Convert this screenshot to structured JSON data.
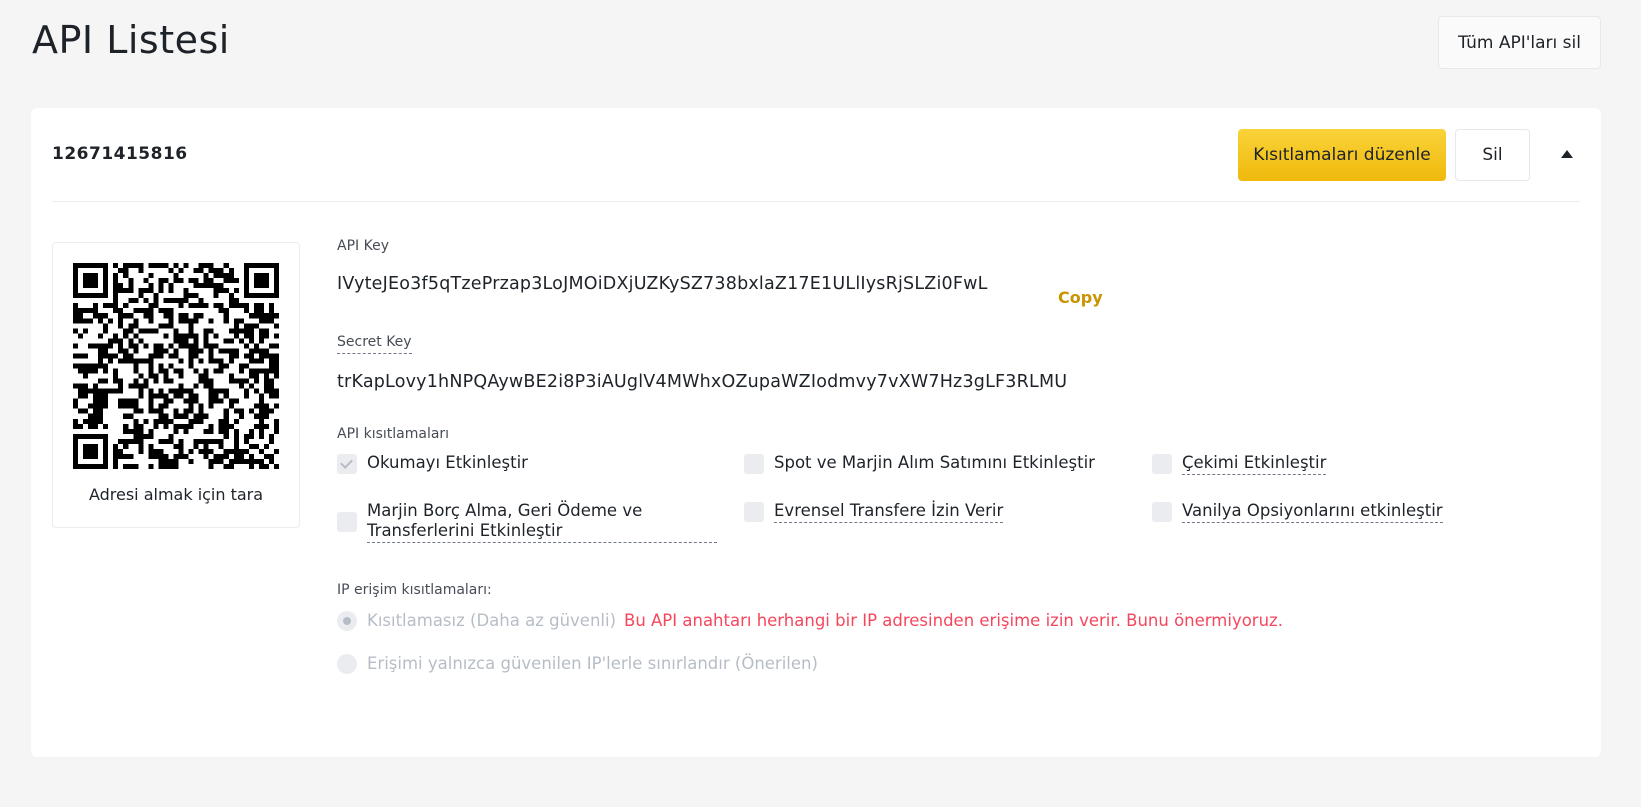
{
  "page": {
    "title": "API Listesi",
    "delete_all_label": "Tüm API'ları sil"
  },
  "api_card": {
    "id": "12671415816",
    "edit_label": "Kısıtlamaları düzenle",
    "delete_label": "Sil",
    "qr_caption": "Adresi almak için tara",
    "api_key_label": "API Key",
    "api_key_value": "IVyteJEo3f5qTzePrzap3LoJMOiDXjUZKySZ738bxlaZ17E1ULlIysRjSLZi0FwL",
    "copy_label": "Copy",
    "secret_key_label": "Secret Key",
    "secret_key_value": "trKapLovy1hNPQAywBE2i8P3iAUglV4MWhxOZupaWZIodmvy7vXW7Hz3gLF3RLMU",
    "restrictions_label": "API kısıtlamaları",
    "restrictions": {
      "read": "Okumayı Etkinleştir",
      "spot": "Spot ve Marjin Alım Satımını Etkinleştir",
      "withdraw": "Çekimi Etkinleştir",
      "margin_line1": "Marjin Borç Alma, Geri Ödeme ve",
      "margin_line2": "Transferlerini Etkinleştir",
      "universal": "Evrensel Transfere İzin Verir",
      "vanilla": "Vanilya Opsiyonlarını etkinleştir"
    },
    "ip_label": "IP erişim kısıtlamaları:",
    "ip_unrestricted": "Kısıtlamasız (Daha az güvenli)",
    "ip_warning": "Bu API anahtarı herhangi bir IP adresinden erişime izin verir. Bunu önermiyoruz.",
    "ip_trusted": "Erişimi yalnızca güvenilen IP'lerle sınırlandır (Önerilen)"
  },
  "colors": {
    "accent": "#f0b90b",
    "link": "#c99400",
    "warning": "#f6465d"
  }
}
